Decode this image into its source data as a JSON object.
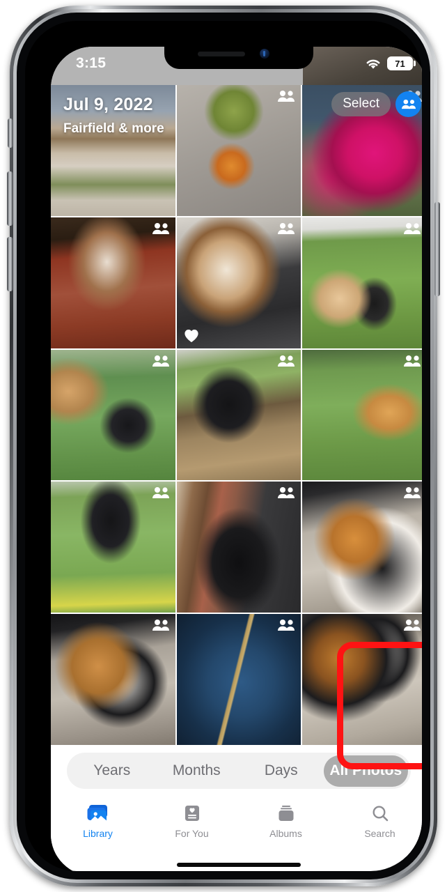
{
  "status_bar": {
    "time": "3:15",
    "wifi_icon": "wifi-icon",
    "battery_level": "71"
  },
  "header": {
    "date": "Jul 9, 2022",
    "subtitle": "Fairfield & more",
    "select_label": "Select",
    "share_icon": "shared-people-icon"
  },
  "grid": {
    "people_badge_icon": "shared-people-icon",
    "favorite_badge_icon": "heart-icon",
    "photos": [
      {
        "name": "photo-house-driveway",
        "alt": "Adobe house with driveway and garden",
        "shared": false,
        "favorite": false
      },
      {
        "name": "photo-smoothie-bowl",
        "alt": "Green smoothie and acai bowl",
        "shared": true,
        "favorite": false
      },
      {
        "name": "photo-pink-bougainvillea",
        "alt": "Pink bougainvillea bush",
        "shared": false,
        "favorite": false
      },
      {
        "name": "photo-dog-on-rug",
        "alt": "Brown and white dog on red rug",
        "shared": true,
        "favorite": false
      },
      {
        "name": "photo-dog-on-couch",
        "alt": "Beagle mix lying on dark couch",
        "shared": true,
        "favorite": true
      },
      {
        "name": "photo-dogs-on-turf",
        "alt": "Poodles playing on green turf",
        "shared": true,
        "favorite": false
      },
      {
        "name": "photo-dogs-by-fence",
        "alt": "Two dogs near chain link fence",
        "shared": true,
        "favorite": false
      },
      {
        "name": "photo-black-dog-deck",
        "alt": "Black dog on wooden deck",
        "shared": true,
        "favorite": false
      },
      {
        "name": "photo-tan-dog-fence",
        "alt": "Tan dog walking along fence",
        "shared": true,
        "favorite": false
      },
      {
        "name": "photo-dog-running",
        "alt": "Black and white dog running on turf",
        "shared": true,
        "favorite": false
      },
      {
        "name": "photo-dog-by-bookshelf",
        "alt": "Black dog resting by bookshelf",
        "shared": true,
        "favorite": false
      },
      {
        "name": "photo-two-cats-bed",
        "alt": "Orange and calico cats in pet bed",
        "shared": true,
        "favorite": false
      },
      {
        "name": "photo-cats-curled",
        "alt": "Cats curled together in bed",
        "shared": true,
        "favorite": false
      },
      {
        "name": "photo-blue-leaf",
        "alt": "Blue leaf with water droplets",
        "shared": true,
        "favorite": false
      },
      {
        "name": "photo-calico-cat",
        "alt": "Calico cat in pet bed",
        "shared": true,
        "favorite": false,
        "highlighted": true
      }
    ]
  },
  "segmented_control": {
    "options": [
      "Years",
      "Months",
      "Days",
      "All Photos"
    ],
    "selected": "All Photos"
  },
  "tab_bar": {
    "tabs": [
      {
        "label": "Library",
        "icon": "photo-library-icon",
        "active": true
      },
      {
        "label": "For You",
        "icon": "for-you-card-icon",
        "active": false
      },
      {
        "label": "Albums",
        "icon": "albums-stack-icon",
        "active": false
      },
      {
        "label": "Search",
        "icon": "search-icon",
        "active": false
      }
    ]
  },
  "highlight": {
    "color": "#fe1313",
    "target": "photo-calico-cat"
  },
  "device": {
    "mute_switch": "mute-switch",
    "volume_up": "volume-up-button",
    "volume_down": "volume-down-button",
    "power": "power-button",
    "home_indicator": "home-indicator"
  }
}
